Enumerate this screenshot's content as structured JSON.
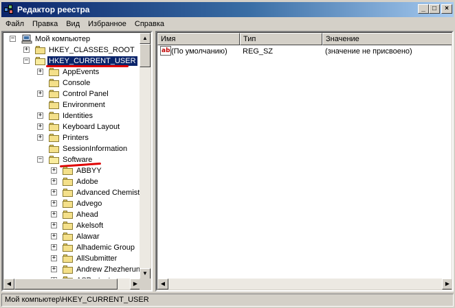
{
  "window": {
    "title": "Редактор реестра",
    "controls": {
      "minimize": "_",
      "maximize": "□",
      "close": "×"
    }
  },
  "menu": [
    "Файл",
    "Правка",
    "Вид",
    "Избранное",
    "Справка"
  ],
  "tree": {
    "root": "Мой компьютер",
    "nodes": [
      {
        "label": "HKEY_CLASSES_ROOT",
        "level": 1,
        "expander": "+"
      },
      {
        "label": "HKEY_CURRENT_USER",
        "level": 1,
        "expander": "−",
        "selected": true
      },
      {
        "label": "AppEvents",
        "level": 2,
        "expander": "+"
      },
      {
        "label": "Console",
        "level": 2,
        "expander": ""
      },
      {
        "label": "Control Panel",
        "level": 2,
        "expander": "+"
      },
      {
        "label": "Environment",
        "level": 2,
        "expander": ""
      },
      {
        "label": "Identities",
        "level": 2,
        "expander": "+"
      },
      {
        "label": "Keyboard Layout",
        "level": 2,
        "expander": "+"
      },
      {
        "label": "Printers",
        "level": 2,
        "expander": "+"
      },
      {
        "label": "SessionInformation",
        "level": 2,
        "expander": ""
      },
      {
        "label": "Software",
        "level": 2,
        "expander": "−",
        "open": true
      },
      {
        "label": "ABBYY",
        "level": 3,
        "expander": "+"
      },
      {
        "label": "Adobe",
        "level": 3,
        "expander": "+"
      },
      {
        "label": "Advanced Chemistry",
        "level": 3,
        "expander": "+"
      },
      {
        "label": "Advego",
        "level": 3,
        "expander": "+"
      },
      {
        "label": "Ahead",
        "level": 3,
        "expander": "+"
      },
      {
        "label": "Akelsoft",
        "level": 3,
        "expander": "+"
      },
      {
        "label": "Alawar",
        "level": 3,
        "expander": "+"
      },
      {
        "label": "Alhademic Group",
        "level": 3,
        "expander": "+"
      },
      {
        "label": "AllSubmitter",
        "level": 3,
        "expander": "+"
      },
      {
        "label": "Andrew Zhezherun",
        "level": 3,
        "expander": "+"
      },
      {
        "label": "ASProtect",
        "level": 3,
        "expander": "+"
      }
    ]
  },
  "list": {
    "columns": [
      "Имя",
      "Тип",
      "Значение"
    ],
    "rows": [
      {
        "name": "(По умолчанию)",
        "type": "REG_SZ",
        "value": "(значение не присвоено)",
        "icon": "string-value-icon",
        "icon_text": "ab"
      }
    ]
  },
  "status": "Мой компьютер\\HKEY_CURRENT_USER",
  "colors": {
    "selection": "#0a246a",
    "annotation": "#e00000",
    "folder": "#f4e08a"
  }
}
